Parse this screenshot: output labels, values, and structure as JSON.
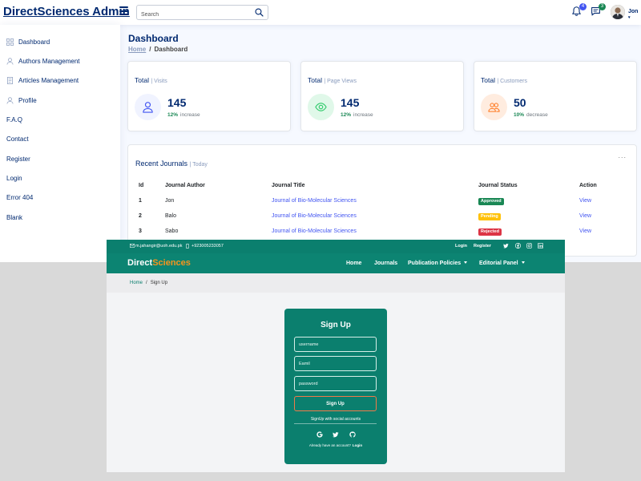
{
  "admin": {
    "brand": "DirectSciences Admin",
    "search_placeholder": "Search",
    "notifications_count": "4",
    "messages_count": "3",
    "profile_name": "Jon",
    "sidebar": [
      {
        "label": "Dashboard",
        "icon": "grid-icon"
      },
      {
        "label": "Authors Management",
        "icon": "person-icon"
      },
      {
        "label": "Articles Management",
        "icon": "document-icon"
      },
      {
        "label": "Profile",
        "icon": "person-icon"
      },
      {
        "label": "F.A.Q",
        "icon": ""
      },
      {
        "label": "Contact",
        "icon": ""
      },
      {
        "label": "Register",
        "icon": ""
      },
      {
        "label": "Login",
        "icon": ""
      },
      {
        "label": "Error 404",
        "icon": ""
      },
      {
        "label": "Blank",
        "icon": ""
      }
    ],
    "page_title": "Dashboard",
    "breadcrumb": {
      "home": "Home",
      "sep": "/",
      "current": "Dashboard"
    },
    "cards": [
      {
        "title": "Total",
        "sub": "| Visits",
        "value": "145",
        "pct": "12%",
        "change": "increase",
        "icon": "person-icon",
        "icon_bg": "#f0f3ff",
        "icon_color": "#4154f1"
      },
      {
        "title": "Total",
        "sub": "| Page Views",
        "value": "145",
        "pct": "12%",
        "change": "increase",
        "icon": "eye-icon",
        "icon_bg": "#e0f8e9",
        "icon_color": "#2eca6a"
      },
      {
        "title": "Total",
        "sub": "| Customers",
        "value": "50",
        "pct": "10%",
        "change": "decrease",
        "icon": "people-icon",
        "icon_bg": "#ffecdf",
        "icon_color": "#ff771d"
      }
    ],
    "journals": {
      "title": "Recent Journals",
      "sub": "| Today",
      "menu": "...",
      "columns": [
        "Id",
        "Journal Author",
        "Journal Title",
        "Journal Status",
        "Action"
      ],
      "rows": [
        {
          "id": "1",
          "author": "Jon",
          "title": "Journal of Bio-Molecular Sciences",
          "status": "Approved",
          "status_color": "#198754",
          "action": "View"
        },
        {
          "id": "2",
          "author": "Balo",
          "title": "Journal of Bio-Molecular Sciences",
          "status": "Pending",
          "status_color": "#ffc107",
          "action": "View"
        },
        {
          "id": "3",
          "author": "Sabo",
          "title": "Journal of Bio-Molecular Sciences",
          "status": "Rejected",
          "status_color": "#dc3545",
          "action": "View"
        }
      ]
    }
  },
  "site": {
    "email": "m.jahangir@uoh.edu.pk",
    "phone": "+923005233057",
    "top_links": [
      "Login",
      "Register"
    ],
    "logo_a": "Direct",
    "logo_b": "Sciences",
    "nav": [
      "Home",
      "Journals",
      "Publication Policies",
      "Editorial Panel"
    ],
    "breadcrumb": {
      "home": "Home",
      "sep": "/",
      "current": "Sign Up"
    },
    "signup": {
      "title": "Sign Up",
      "username_placeholder": "username",
      "email_placeholder": "Eamil",
      "password_placeholder": "password",
      "submit": "Sign Up",
      "social_label": "SignUp with social accounts",
      "already": "Already have an account?",
      "login": "Login"
    }
  }
}
